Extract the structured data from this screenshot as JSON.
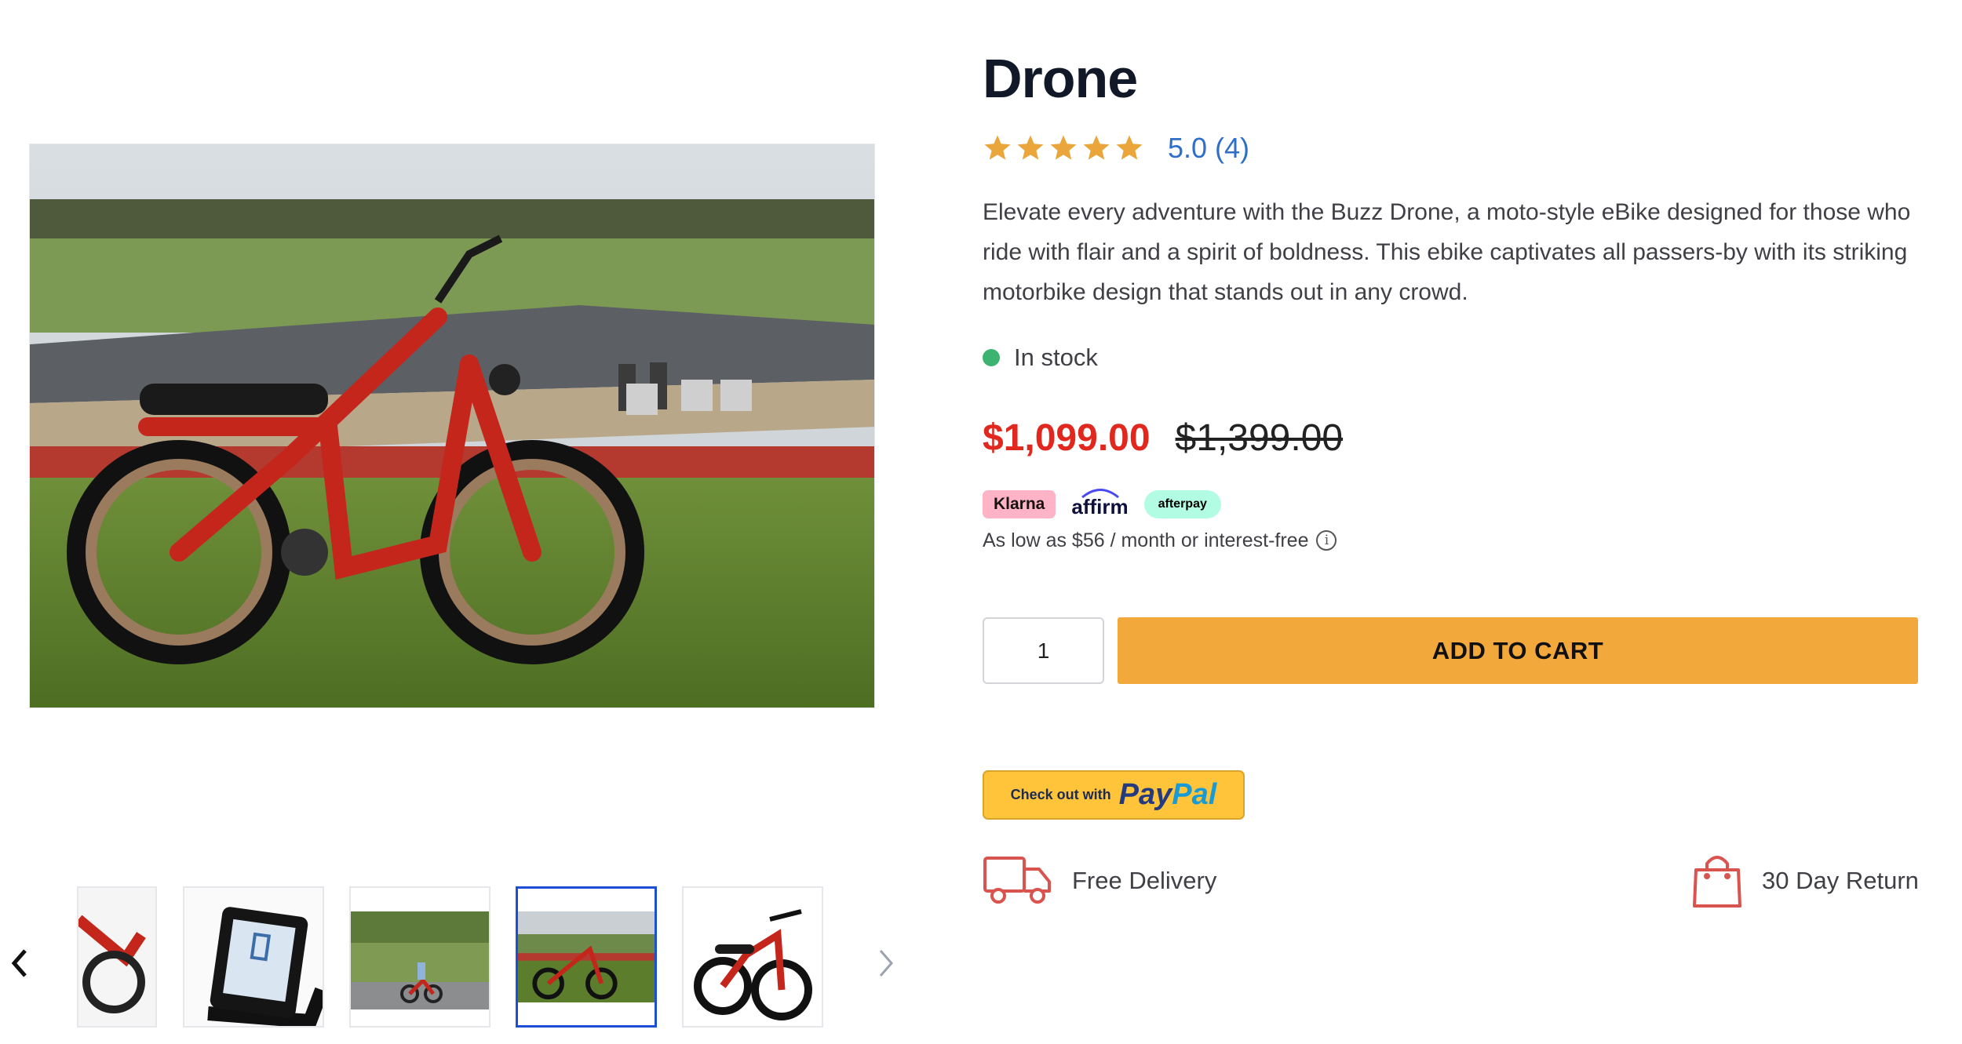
{
  "product": {
    "title": "Drone",
    "rating": 5,
    "rating_text": "5.0 (4)",
    "description": "Elevate every adventure with the Buzz Drone, a moto-style eBike designed for those who ride with flair and a spirit of boldness. This ebike captivates all passers-by with its striking motorbike design that stands out in any crowd.",
    "stock_status": "In stock",
    "price_sale": "$1,099.00",
    "price_original": "$1,399.00"
  },
  "financing": {
    "providers": [
      "Klarna",
      "affirm",
      "afterpay"
    ],
    "text": "As low as $56 / month or interest-free",
    "info_icon": "info-icon"
  },
  "cart": {
    "quantity": "1",
    "add_label": "ADD TO CART"
  },
  "paypal": {
    "prefix": "Check out with",
    "logo_pay": "Pay",
    "logo_pal": "Pal"
  },
  "perks": [
    {
      "label": "Free Delivery",
      "icon": "truck-icon"
    },
    {
      "label": "30 Day Return",
      "icon": "shopping-bag-icon"
    }
  ],
  "gallery": {
    "active_index": 3,
    "thumb_count": 5
  },
  "colors": {
    "accent": "#f2a83b",
    "sale_price": "#e0281e",
    "star": "#eaa63a",
    "link": "#2f6fc7",
    "in_stock": "#3cb371",
    "perk_icon": "#d9534f",
    "active_thumb_border": "#1d4ed8"
  }
}
